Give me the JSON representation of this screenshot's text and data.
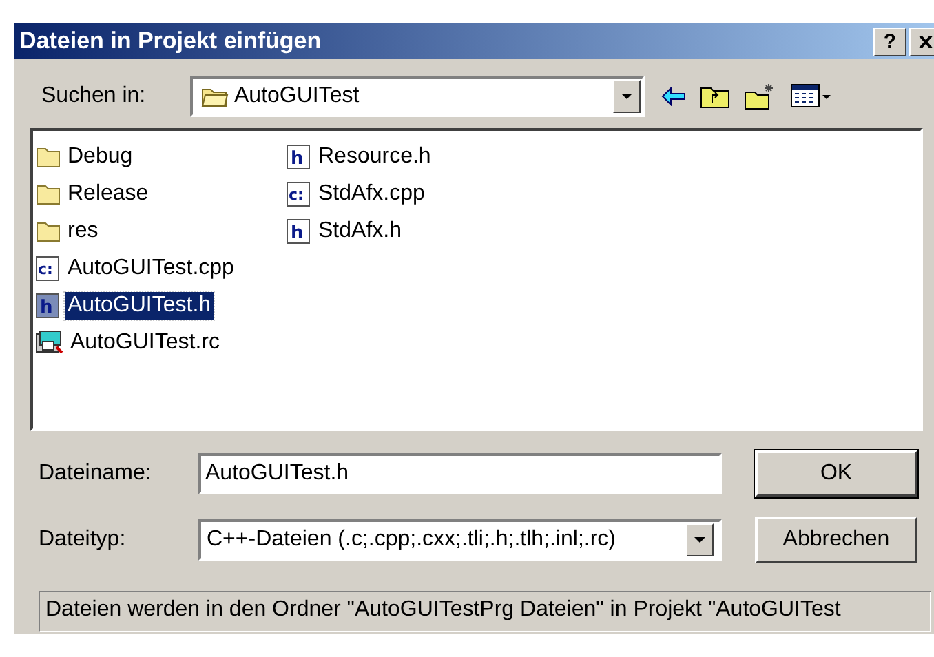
{
  "window": {
    "title": "Dateien in Projekt einfügen",
    "help_button": "?"
  },
  "look_in": {
    "label": "Suchen in:",
    "value": "AutoGUITest"
  },
  "files": [
    {
      "name": "Debug",
      "kind": "folder",
      "selected": false
    },
    {
      "name": "Release",
      "kind": "folder",
      "selected": false
    },
    {
      "name": "res",
      "kind": "folder",
      "selected": false
    },
    {
      "name": "AutoGUITest.cpp",
      "kind": "cpp",
      "icon_text": "c:",
      "selected": false
    },
    {
      "name": "AutoGUITest.h",
      "kind": "header",
      "icon_text": "h",
      "selected": true
    },
    {
      "name": "AutoGUITest.rc",
      "kind": "resource",
      "selected": false
    },
    {
      "name": "Resource.h",
      "kind": "header",
      "icon_text": "h",
      "selected": false
    },
    {
      "name": "StdAfx.cpp",
      "kind": "cpp",
      "icon_text": "c:",
      "selected": false
    },
    {
      "name": "StdAfx.h",
      "kind": "header",
      "icon_text": "h",
      "selected": false
    }
  ],
  "filename": {
    "label": "Dateiname:",
    "value": "AutoGUITest.h"
  },
  "filetype": {
    "label": "Dateityp:",
    "value": "C++-Dateien (.c;.cpp;.cxx;.tli;.h;.tlh;.inl;.rc)"
  },
  "buttons": [
    "OK",
    "Abbrechen"
  ],
  "status": "Dateien werden in den Ordner \"AutoGUITestPrg Dateien\" in Projekt \"AutoGUITest"
}
